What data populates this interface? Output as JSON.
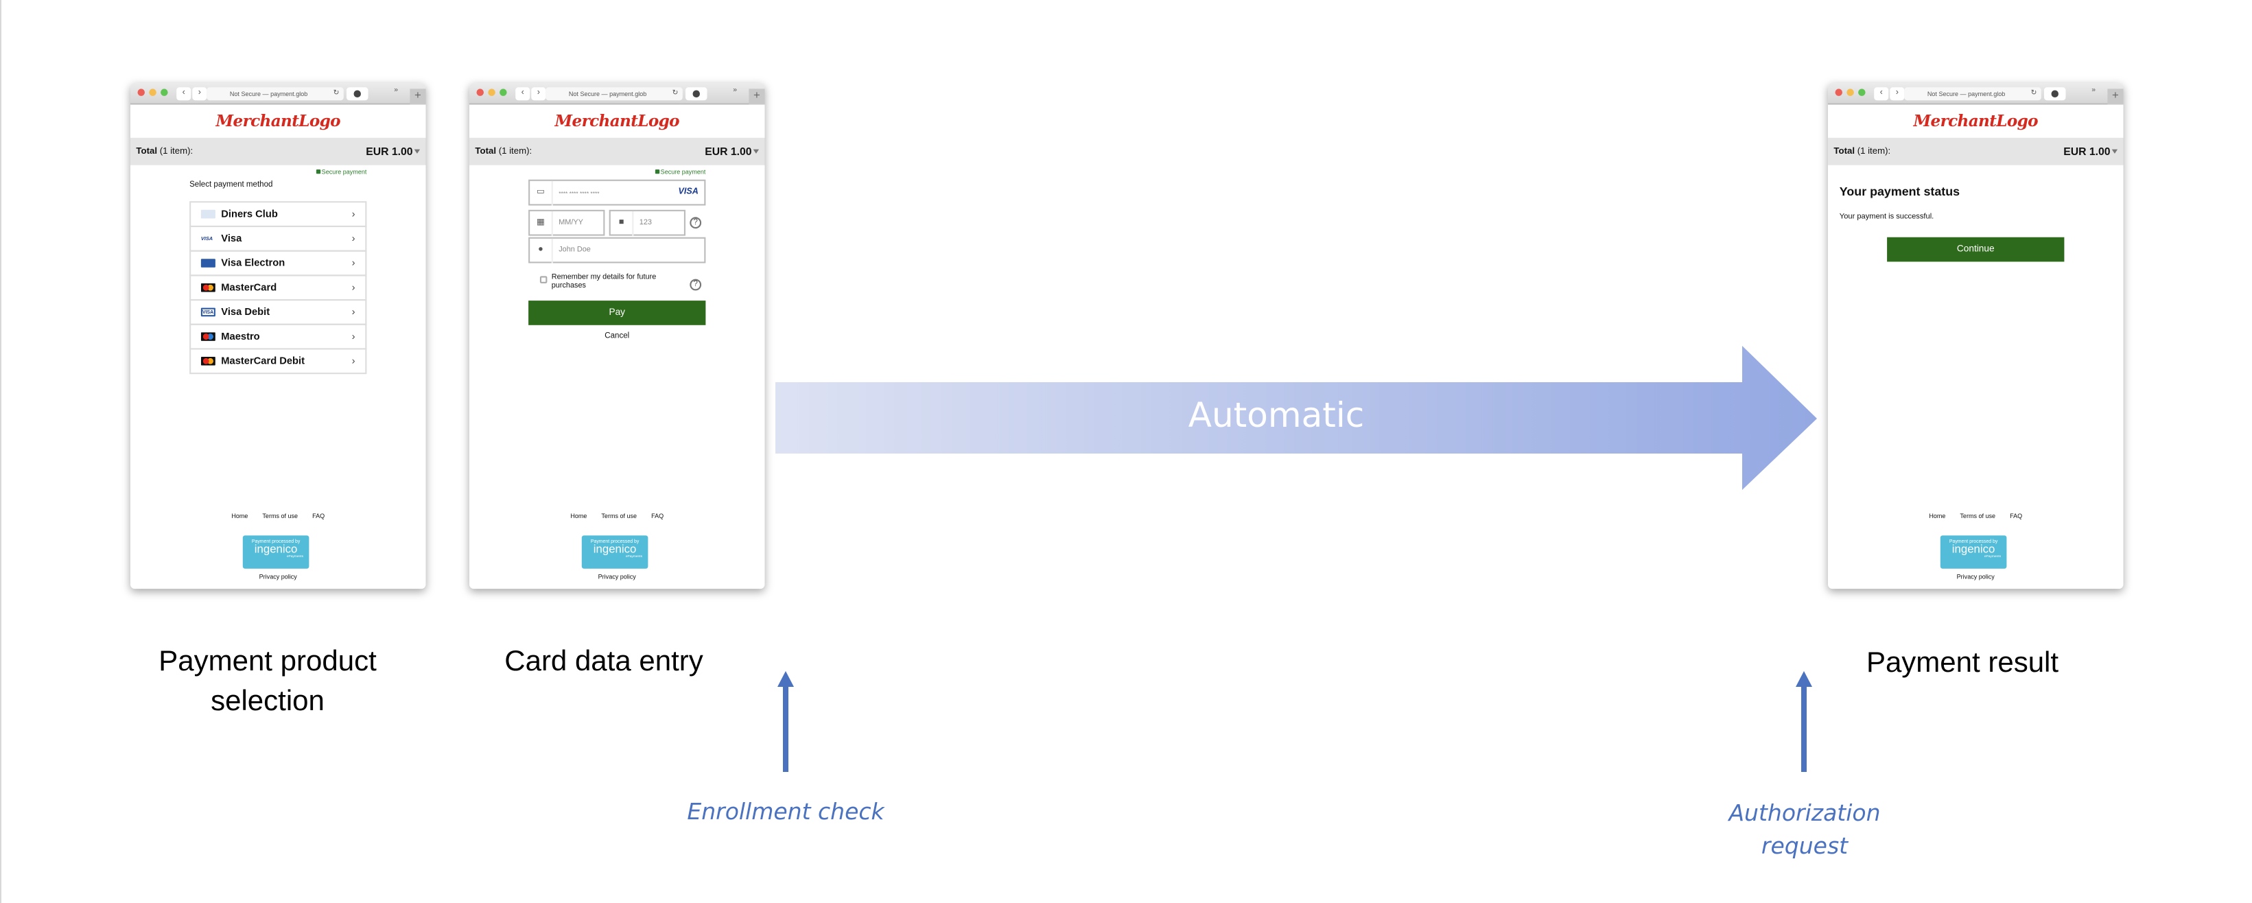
{
  "browser": {
    "url": "Not Secure — payment.glob",
    "logo": "MerchantLogo",
    "total_label": "Total",
    "total_items": "(1 item):",
    "amount": "EUR 1.00",
    "secure": "Secure payment",
    "footer": {
      "home": "Home",
      "terms": "Terms of use",
      "faq": "FAQ",
      "privacy": "Privacy policy",
      "badge_line1": "Payment processed by",
      "badge_brand": "ingenico",
      "badge_sub": "ePayments"
    }
  },
  "screen1": {
    "heading": "Select payment method",
    "methods": [
      {
        "label": "Diners Club",
        "icon": "diners-club-icon"
      },
      {
        "label": "Visa",
        "icon": "visa-icon"
      },
      {
        "label": "Visa Electron",
        "icon": "visa-electron-icon"
      },
      {
        "label": "MasterCard",
        "icon": "mastercard-icon"
      },
      {
        "label": "Visa Debit",
        "icon": "visa-debit-icon"
      },
      {
        "label": "Maestro",
        "icon": "maestro-icon"
      },
      {
        "label": "MasterCard Debit",
        "icon": "mastercard-debit-icon"
      }
    ]
  },
  "screen2": {
    "card_placeholder": "**** **** **** ****",
    "card_brand": "VISA",
    "expiry_placeholder": "MM/YY",
    "cvc_placeholder": "123",
    "name_placeholder": "John Doe",
    "remember": "Remember my details for future purchases",
    "help": "?",
    "pay": "Pay",
    "cancel": "Cancel"
  },
  "screen3": {
    "heading": "Your payment status",
    "message": "Your payment is successful.",
    "continue": "Continue"
  },
  "diagram": {
    "arrow_label": "Automatic",
    "labels": [
      "Payment product selection",
      "Card data entry",
      "Payment result"
    ],
    "notes": [
      "Enrollment check",
      "Authorization request"
    ],
    "colors": {
      "arrow_start": "#dde2f3",
      "arrow_end": "#94a8e2",
      "note": "#4a72bf",
      "button": "#2e6a1b"
    }
  }
}
